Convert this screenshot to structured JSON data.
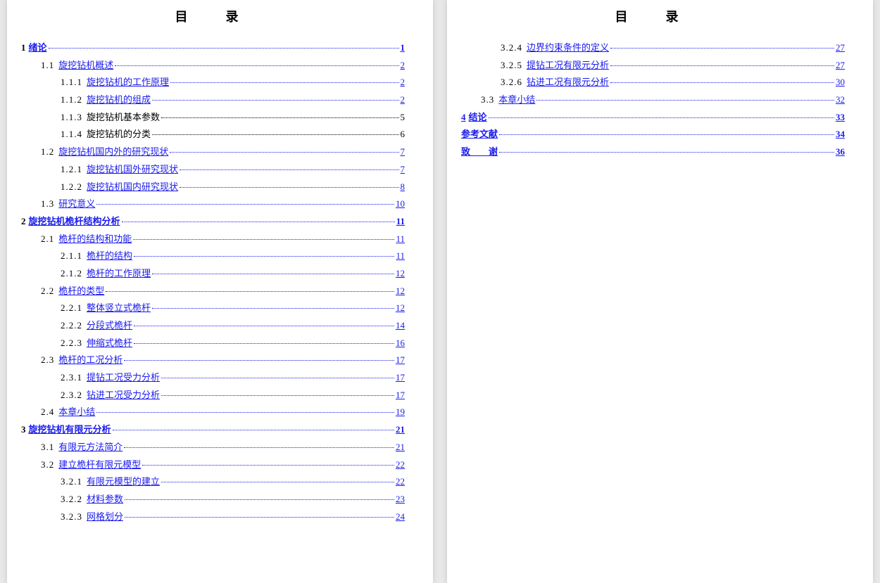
{
  "title": "目　录",
  "pages": [
    {
      "entries": [
        {
          "lvl": 0,
          "num": "1",
          "txt": "绪论",
          "pg": "1",
          "link": true,
          "numLink": false
        },
        {
          "lvl": 1,
          "num": "1.1",
          "txt": "旋挖钻机概述",
          "pg": "2",
          "link": true
        },
        {
          "lvl": 2,
          "num": "1.1.1",
          "txt": "旋挖钻机的工作原理",
          "pg": "2",
          "link": true
        },
        {
          "lvl": 2,
          "num": "1.1.2",
          "txt": "旋挖钻机的组成",
          "pg": "2",
          "link": true
        },
        {
          "lvl": 2,
          "num": "1.1.3",
          "txt": "旋挖钻机基本参数",
          "pg": "5",
          "link": false
        },
        {
          "lvl": 2,
          "num": "1.1.4",
          "txt": "旋挖钻机的分类",
          "pg": "6",
          "link": false
        },
        {
          "lvl": 1,
          "num": "1.2",
          "txt": "旋挖钻机国内外的研究现状",
          "pg": "7",
          "link": true
        },
        {
          "lvl": 2,
          "num": "1.2.1",
          "txt": "旋挖钻机国外研究现状",
          "pg": "7",
          "link": true
        },
        {
          "lvl": 2,
          "num": "1.2.2",
          "txt": "旋挖钻机国内研究现状",
          "pg": "8",
          "link": true
        },
        {
          "lvl": 1,
          "num": "1.3",
          "txt": "研究意义",
          "pg": "10",
          "link": true
        },
        {
          "lvl": 0,
          "num": "2",
          "txt": "旋挖钻机桅杆结构分析",
          "pg": "11",
          "link": true,
          "numLink": false
        },
        {
          "lvl": 1,
          "num": "2.1",
          "txt": "桅杆的结构和功能",
          "pg": "11",
          "link": true
        },
        {
          "lvl": 2,
          "num": "2.1.1",
          "txt": "桅杆的结构",
          "pg": "11",
          "link": true
        },
        {
          "lvl": 2,
          "num": "2.1.2",
          "txt": "桅杆的工作原理",
          "pg": "12",
          "link": true
        },
        {
          "lvl": 1,
          "num": "2.2",
          "txt": "桅杆的类型",
          "pg": "12",
          "link": true
        },
        {
          "lvl": 2,
          "num": "2.2.1",
          "txt": "整体竖立式桅杆",
          "pg": "12",
          "link": true
        },
        {
          "lvl": 2,
          "num": "2.2.2",
          "txt": "分段式桅杆",
          "pg": "14",
          "link": true
        },
        {
          "lvl": 2,
          "num": "2.2.3",
          "txt": "伸缩式桅杆",
          "pg": "16",
          "link": true
        },
        {
          "lvl": 1,
          "num": "2.3",
          "txt": "桅杆的工况分析",
          "pg": "17",
          "link": true
        },
        {
          "lvl": 2,
          "num": "2.3.1",
          "txt": "提钻工况受力分析",
          "pg": "17",
          "link": true
        },
        {
          "lvl": 2,
          "num": "2.3.2",
          "txt": "钻进工况受力分析",
          "pg": "17",
          "link": true
        },
        {
          "lvl": 1,
          "num": "2.4",
          "txt": "本章小结",
          "pg": "19",
          "link": true
        },
        {
          "lvl": 0,
          "num": "3",
          "txt": "旋挖钻机有限元分析",
          "pg": "21",
          "link": true,
          "numLink": false
        },
        {
          "lvl": 1,
          "num": "3.1",
          "txt": "有限元方法简介",
          "pg": "21",
          "link": true
        },
        {
          "lvl": 1,
          "num": "3.2",
          "txt": "建立桅杆有限元模型",
          "pg": "22",
          "link": true
        },
        {
          "lvl": 2,
          "num": "3.2.1",
          "txt": "有限元模型的建立",
          "pg": "22",
          "link": true
        },
        {
          "lvl": 2,
          "num": "3.2.2",
          "txt": "材料参数",
          "pg": "23",
          "link": true
        },
        {
          "lvl": 2,
          "num": "3.2.3",
          "txt": "网格划分",
          "pg": "24",
          "link": true
        }
      ]
    },
    {
      "entries": [
        {
          "lvl": 2,
          "num": "3.2.4",
          "txt": "边界约束条件的定义",
          "pg": "27",
          "link": true
        },
        {
          "lvl": 2,
          "num": "3.2.5",
          "txt": "提钻工况有限元分析",
          "pg": "27",
          "link": true
        },
        {
          "lvl": 2,
          "num": "3.2.6",
          "txt": "钻进工况有限元分析",
          "pg": "30",
          "link": true
        },
        {
          "lvl": 1,
          "num": "3.3",
          "txt": "本章小结",
          "pg": "32",
          "link": true
        },
        {
          "lvl": 0,
          "num": "4",
          "txt": "结论",
          "pg": "33",
          "link": true,
          "numLink": true
        },
        {
          "lvl": 0,
          "num": "",
          "txt": "参考文献",
          "pg": "34",
          "link": true,
          "numLink": true
        },
        {
          "lvl": 0,
          "num": "",
          "txt": "致　　谢",
          "pg": "36",
          "link": true,
          "numLink": true
        }
      ]
    }
  ]
}
